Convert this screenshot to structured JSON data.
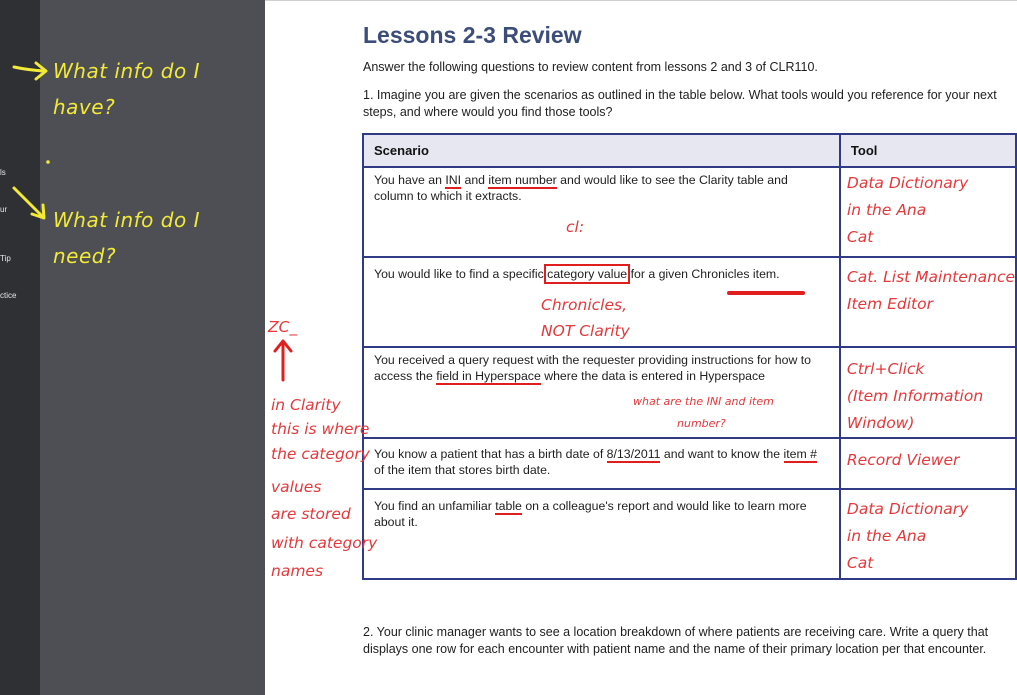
{
  "left_panel": {
    "nav_items": [
      "ls",
      "ur",
      "Tip",
      "ctice"
    ],
    "annotations": {
      "have_line1": "What info do I",
      "have_line2": "have?",
      "need_line1": "What info do I",
      "need_line2": "need?"
    }
  },
  "document": {
    "title": "Lessons 2-3 Review",
    "intro": "Answer the following questions to review content from lessons 2 and 3 of CLR110.",
    "question1": "1. Imagine you are given the scenarios as outlined in the table below. What tools would you reference for your next steps, and where would you find those tools?",
    "table": {
      "headers": [
        "Scenario",
        "Tool"
      ],
      "rows": [
        {
          "pre": "You have an ",
          "t1": "INI",
          "m1": " and ",
          "t2": "item number",
          "post": " and would like to see the Clarity table and column to which it extracts.",
          "tool": [
            "Data Dictionary",
            "in the Ana",
            "Cat"
          ]
        },
        {
          "pre": "You would like to find a specific ",
          "t1": "category value",
          "m1": " for a given ",
          "t2": "Chronicles",
          "post": " item.",
          "tool": [
            "Cat. List Maintenance",
            "Item Editor"
          ]
        },
        {
          "pre": "You received a query request with the requester providing instructions for how to access the ",
          "t1": "field in Hyperspace",
          "post": " where the data is entered in Hyperspace",
          "tool": [
            "Ctrl+Click",
            "(Item Information",
            "Window)"
          ]
        },
        {
          "pre": "You know a patient that has a birth date of ",
          "t1": "8/13/2011",
          "m1": " and want to know the ",
          "t2": "item #",
          "post": " of the item that stores birth date.",
          "tool": [
            "Record Viewer"
          ]
        },
        {
          "pre": "You find an unfamiliar ",
          "t1": "table",
          "post": " on a colleague's report and would like to learn more about it.",
          "tool": [
            "Data Dictionary",
            "in the Ana",
            "Cat"
          ]
        }
      ]
    },
    "question2": "2. Your clinic manager wants to see a location breakdown of where patients are receiving care. Write a query that displays one row for each encounter with patient name and the name of their primary location per that encounter."
  },
  "ink": {
    "cl": "cl:",
    "chronicles_not_clarity_1": "Chronicles,",
    "chronicles_not_clarity_2": "NOT Clarity",
    "zc": "ZC_",
    "ini_question_1": "what are the INI and item",
    "ini_question_2": "number?",
    "clarity_note": [
      "in Clarity",
      "this is where",
      "the category",
      "values",
      "are stored",
      "with category",
      "names"
    ]
  },
  "colors": {
    "title": "#3d4d7a",
    "table_border": "#313a85",
    "header_bg": "#e6e7f1",
    "ink_red": "#e5383b",
    "ink_yellow": "#f2ea37",
    "panel_dark": "#4d4f55"
  }
}
